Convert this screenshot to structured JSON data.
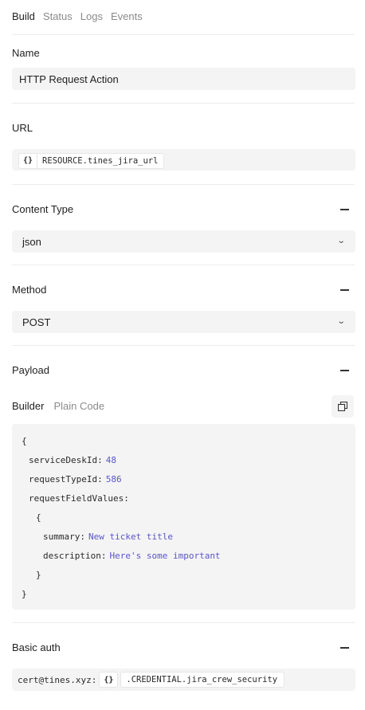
{
  "tabs": [
    {
      "label": "Build"
    },
    {
      "label": "Status"
    },
    {
      "label": "Logs"
    },
    {
      "label": "Events"
    }
  ],
  "name_section": {
    "label": "Name",
    "value": "HTTP Request Action"
  },
  "url_section": {
    "label": "URL",
    "brace": "{}",
    "reference": "RESOURCE.tines_jira_url"
  },
  "content_type": {
    "label": "Content Type",
    "value": "json"
  },
  "method": {
    "label": "Method",
    "value": "POST"
  },
  "payload": {
    "label": "Payload",
    "mode_tabs": [
      {
        "label": "Builder"
      },
      {
        "label": "Plain Code"
      }
    ],
    "open_brace": "{",
    "close_brace": "}",
    "fields": {
      "serviceDeskId": {
        "key": "serviceDeskId",
        "value": "48"
      },
      "requestTypeId": {
        "key": "requestTypeId",
        "value": "586"
      },
      "requestFieldValues": {
        "key": "requestFieldValues"
      },
      "inner_open": "{",
      "inner_close": "}",
      "summary": {
        "key": "summary",
        "value": "New ticket title"
      },
      "description": {
        "key": "description",
        "value": "Here's some important"
      }
    }
  },
  "basic_auth": {
    "label": "Basic auth",
    "user": "cert@tines.xyz:",
    "brace": "{}",
    "reference": ".CREDENTIAL.jira_crew_security"
  },
  "colors": {
    "accent": "#5a55c9",
    "field_bg": "#f4f4f4",
    "muted": "#8a8a8a"
  }
}
